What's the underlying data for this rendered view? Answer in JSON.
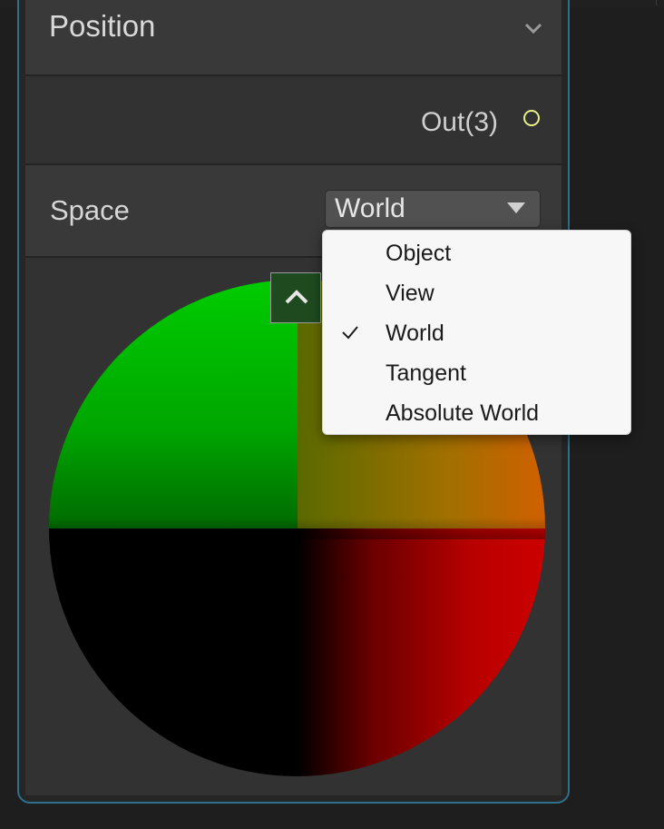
{
  "node": {
    "title": "Position",
    "output_port_label": "Out(3)",
    "space_label": "Space",
    "space_selected": "World"
  },
  "space_menu": {
    "options": [
      {
        "label": "Object",
        "checked": false
      },
      {
        "label": "View",
        "checked": false
      },
      {
        "label": "World",
        "checked": true
      },
      {
        "label": "Tangent",
        "checked": false
      },
      {
        "label": "Absolute World",
        "checked": false
      }
    ]
  },
  "colors": {
    "node_border": "#2e6f8c",
    "port_dot": "#e7ef86",
    "menu_bg": "#f7f7f7"
  },
  "icons": {
    "header_collapse": "chevron-down-icon",
    "preview_collapse": "chevron-up-icon",
    "selected_option": "checkmark-icon",
    "output_port": "circle-port-icon"
  }
}
